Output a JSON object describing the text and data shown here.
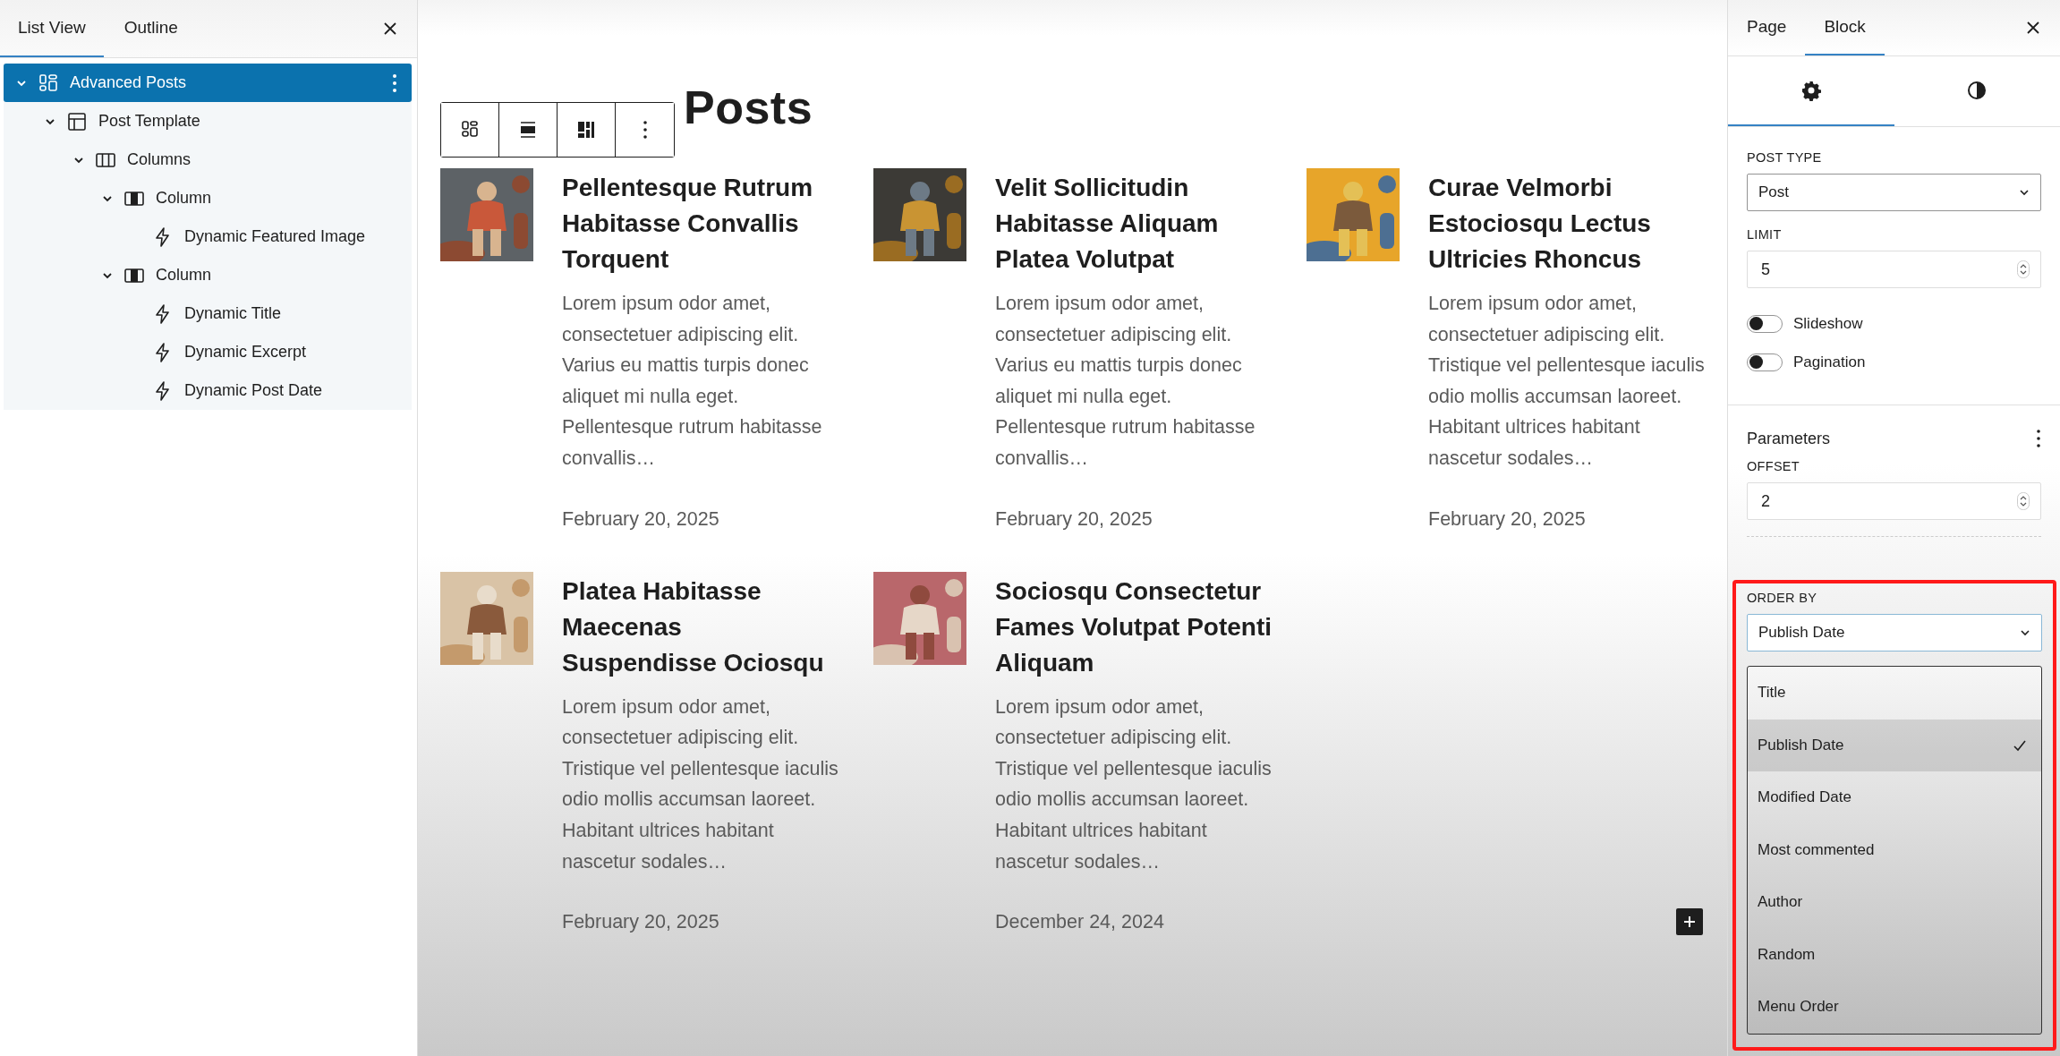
{
  "left_panel": {
    "tabs": [
      {
        "label": "List View",
        "selected": true
      },
      {
        "label": "Outline",
        "selected": false
      }
    ],
    "tree": [
      {
        "label": "Advanced Posts",
        "kind": "query",
        "selected": true,
        "expanded": true,
        "children": [
          {
            "label": "Post Template",
            "kind": "template",
            "selected": false,
            "expanded": true,
            "children": [
              {
                "label": "Columns",
                "kind": "columns",
                "selected": false,
                "expanded": true,
                "children": [
                  {
                    "label": "Column",
                    "kind": "column",
                    "selected": false,
                    "expanded": true,
                    "children": [
                      {
                        "label": "Dynamic Featured Image",
                        "kind": "dynamic",
                        "selected": false
                      }
                    ]
                  },
                  {
                    "label": "Column",
                    "kind": "column",
                    "selected": false,
                    "expanded": true,
                    "children": [
                      {
                        "label": "Dynamic Title",
                        "kind": "dynamic",
                        "selected": false
                      },
                      {
                        "label": "Dynamic Excerpt",
                        "kind": "dynamic",
                        "selected": false
                      },
                      {
                        "label": "Dynamic Post Date",
                        "kind": "dynamic",
                        "selected": false
                      }
                    ]
                  }
                ]
              }
            ]
          }
        ]
      }
    ]
  },
  "canvas": {
    "heading": "Posts",
    "posts": [
      {
        "title": "Pellentesque Rutrum Habitasse Convallis Torquent",
        "excerpt": "Lorem ipsum odor amet, consectetuer adipiscing elit. Varius eu mattis turpis donec aliquet mi nulla eget. Pellentesque rutrum habitasse convallis…",
        "date": "February 20, 2025"
      },
      {
        "title": "Velit Sollicitudin Habitasse Aliquam Platea Volutpat",
        "excerpt": "Lorem ipsum odor amet, consectetuer adipiscing elit. Varius eu mattis turpis donec aliquet mi nulla eget. Pellentesque rutrum habitasse convallis…",
        "date": "February 20, 2025"
      },
      {
        "title": "Curae Velmorbi Estociosqu Lectus Ultricies Rhoncus",
        "excerpt": "Lorem ipsum odor amet, consectetuer adipiscing elit. Tristique vel pellentesque iaculis odio mollis accumsan laoreet. Habitant ultrices habitant nascetur sodales…",
        "date": "February 20, 2025"
      },
      {
        "title": "Platea Habitasse Maecenas Suspendisse Ociosqu",
        "excerpt": "Lorem ipsum odor amet, consectetuer adipiscing elit. Tristique vel pellentesque iaculis odio mollis accumsan laoreet. Habitant ultrices habitant nascetur sodales…",
        "date": "February 20, 2025"
      },
      {
        "title": "Sociosqu Consectetur Fames Volutpat Potenti Aliquam",
        "excerpt": "Lorem ipsum odor amet, consectetuer adipiscing elit. Tristique vel pellentesque iaculis odio mollis accumsan laoreet. Habitant ultrices habitant nascetur sodales…",
        "date": "December 24, 2024"
      }
    ]
  },
  "right_panel": {
    "tabs": [
      {
        "label": "Page",
        "selected": false
      },
      {
        "label": "Block",
        "selected": true
      }
    ],
    "icon_tabs": [
      {
        "kind": "settings",
        "selected": true
      },
      {
        "kind": "styles",
        "selected": false
      }
    ],
    "post_type": {
      "label": "POST TYPE",
      "value": "Post"
    },
    "limit": {
      "label": "LIMIT",
      "value": "5"
    },
    "toggles": [
      {
        "label": "Slideshow",
        "on": false
      },
      {
        "label": "Pagination",
        "on": false
      }
    ],
    "parameters": {
      "title": "Parameters",
      "offset": {
        "label": "OFFSET",
        "value": "2"
      }
    },
    "order_by": {
      "label": "ORDER BY",
      "value": "Publish Date",
      "expanded": true,
      "options": [
        {
          "label": "Title",
          "selected": false
        },
        {
          "label": "Publish Date",
          "selected": true
        },
        {
          "label": "Modified Date",
          "selected": false
        },
        {
          "label": "Most commented",
          "selected": false
        },
        {
          "label": "Author",
          "selected": false
        },
        {
          "label": "Random",
          "selected": false
        },
        {
          "label": "Menu Order",
          "selected": false
        }
      ]
    }
  }
}
